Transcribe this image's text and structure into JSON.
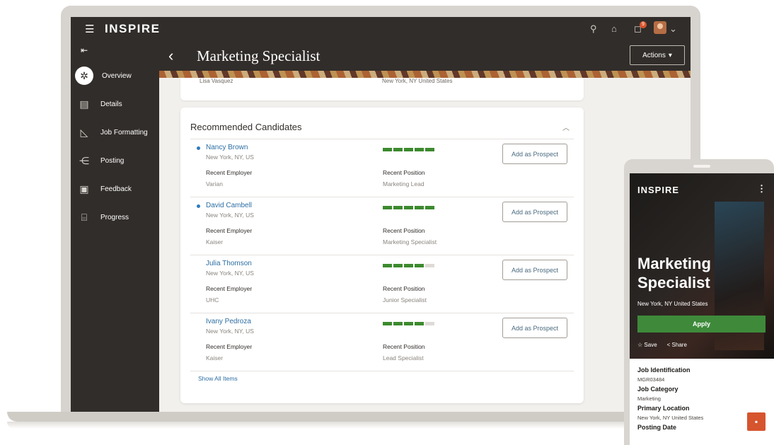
{
  "app": {
    "brand": "INSPIRE",
    "notification_count": "9"
  },
  "header": {
    "title": "Marketing Specialist",
    "actions_label": "Actions"
  },
  "sidebar": {
    "items": [
      {
        "label": "Overview",
        "icon": "overview-icon"
      },
      {
        "label": "Details",
        "icon": "details-icon"
      },
      {
        "label": "Job Formatting",
        "icon": "job-formatting-icon"
      },
      {
        "label": "Posting",
        "icon": "posting-icon"
      },
      {
        "label": "Feedback",
        "icon": "feedback-icon"
      },
      {
        "label": "Progress",
        "icon": "progress-icon"
      }
    ]
  },
  "previous_card": {
    "name": "Lisa Vasquez",
    "location": "New York, NY United States"
  },
  "recommended": {
    "title": "Recommended Candidates",
    "employer_label": "Recent Employer",
    "position_label": "Recent Position",
    "prospect_label": "Add as Prospect",
    "show_all": "Show All Items",
    "candidates": [
      {
        "name": "Nancy Brown",
        "location": "New York, NY, US",
        "employer": "Varian",
        "position": "Marketing Lead",
        "score": 5,
        "new": true
      },
      {
        "name": "David Cambell",
        "location": "New York, NY, US",
        "employer": "Kaiser",
        "position": "Marketing Specialist",
        "score": 5,
        "new": true
      },
      {
        "name": "Julia Thomson",
        "location": "New York, NY, US",
        "employer": "UHC",
        "position": "Junior Specialist",
        "score": 4,
        "new": false
      },
      {
        "name": "Ivany Pedroza",
        "location": "New York, NY, US",
        "employer": "Kaiser",
        "position": "Lead Specialist",
        "score": 4,
        "new": false
      }
    ]
  },
  "mobile": {
    "brand": "INSPIRE",
    "title": "Marketing Specialist",
    "location": "New York, NY United States",
    "apply_label": "Apply",
    "save_label": "Save",
    "share_label": "Share",
    "details": [
      {
        "label": "Job Identification",
        "value": "MGR03484"
      },
      {
        "label": "Job Category",
        "value": "Marketing"
      },
      {
        "label": "Primary Location",
        "value": "New York, NY United States"
      },
      {
        "label": "Posting Date",
        "value": ""
      }
    ]
  },
  "colors": {
    "dark": "#312d2a",
    "accent_green": "#3e8a3a",
    "link_blue": "#2d6ea3",
    "chat_orange": "#d6542e"
  }
}
